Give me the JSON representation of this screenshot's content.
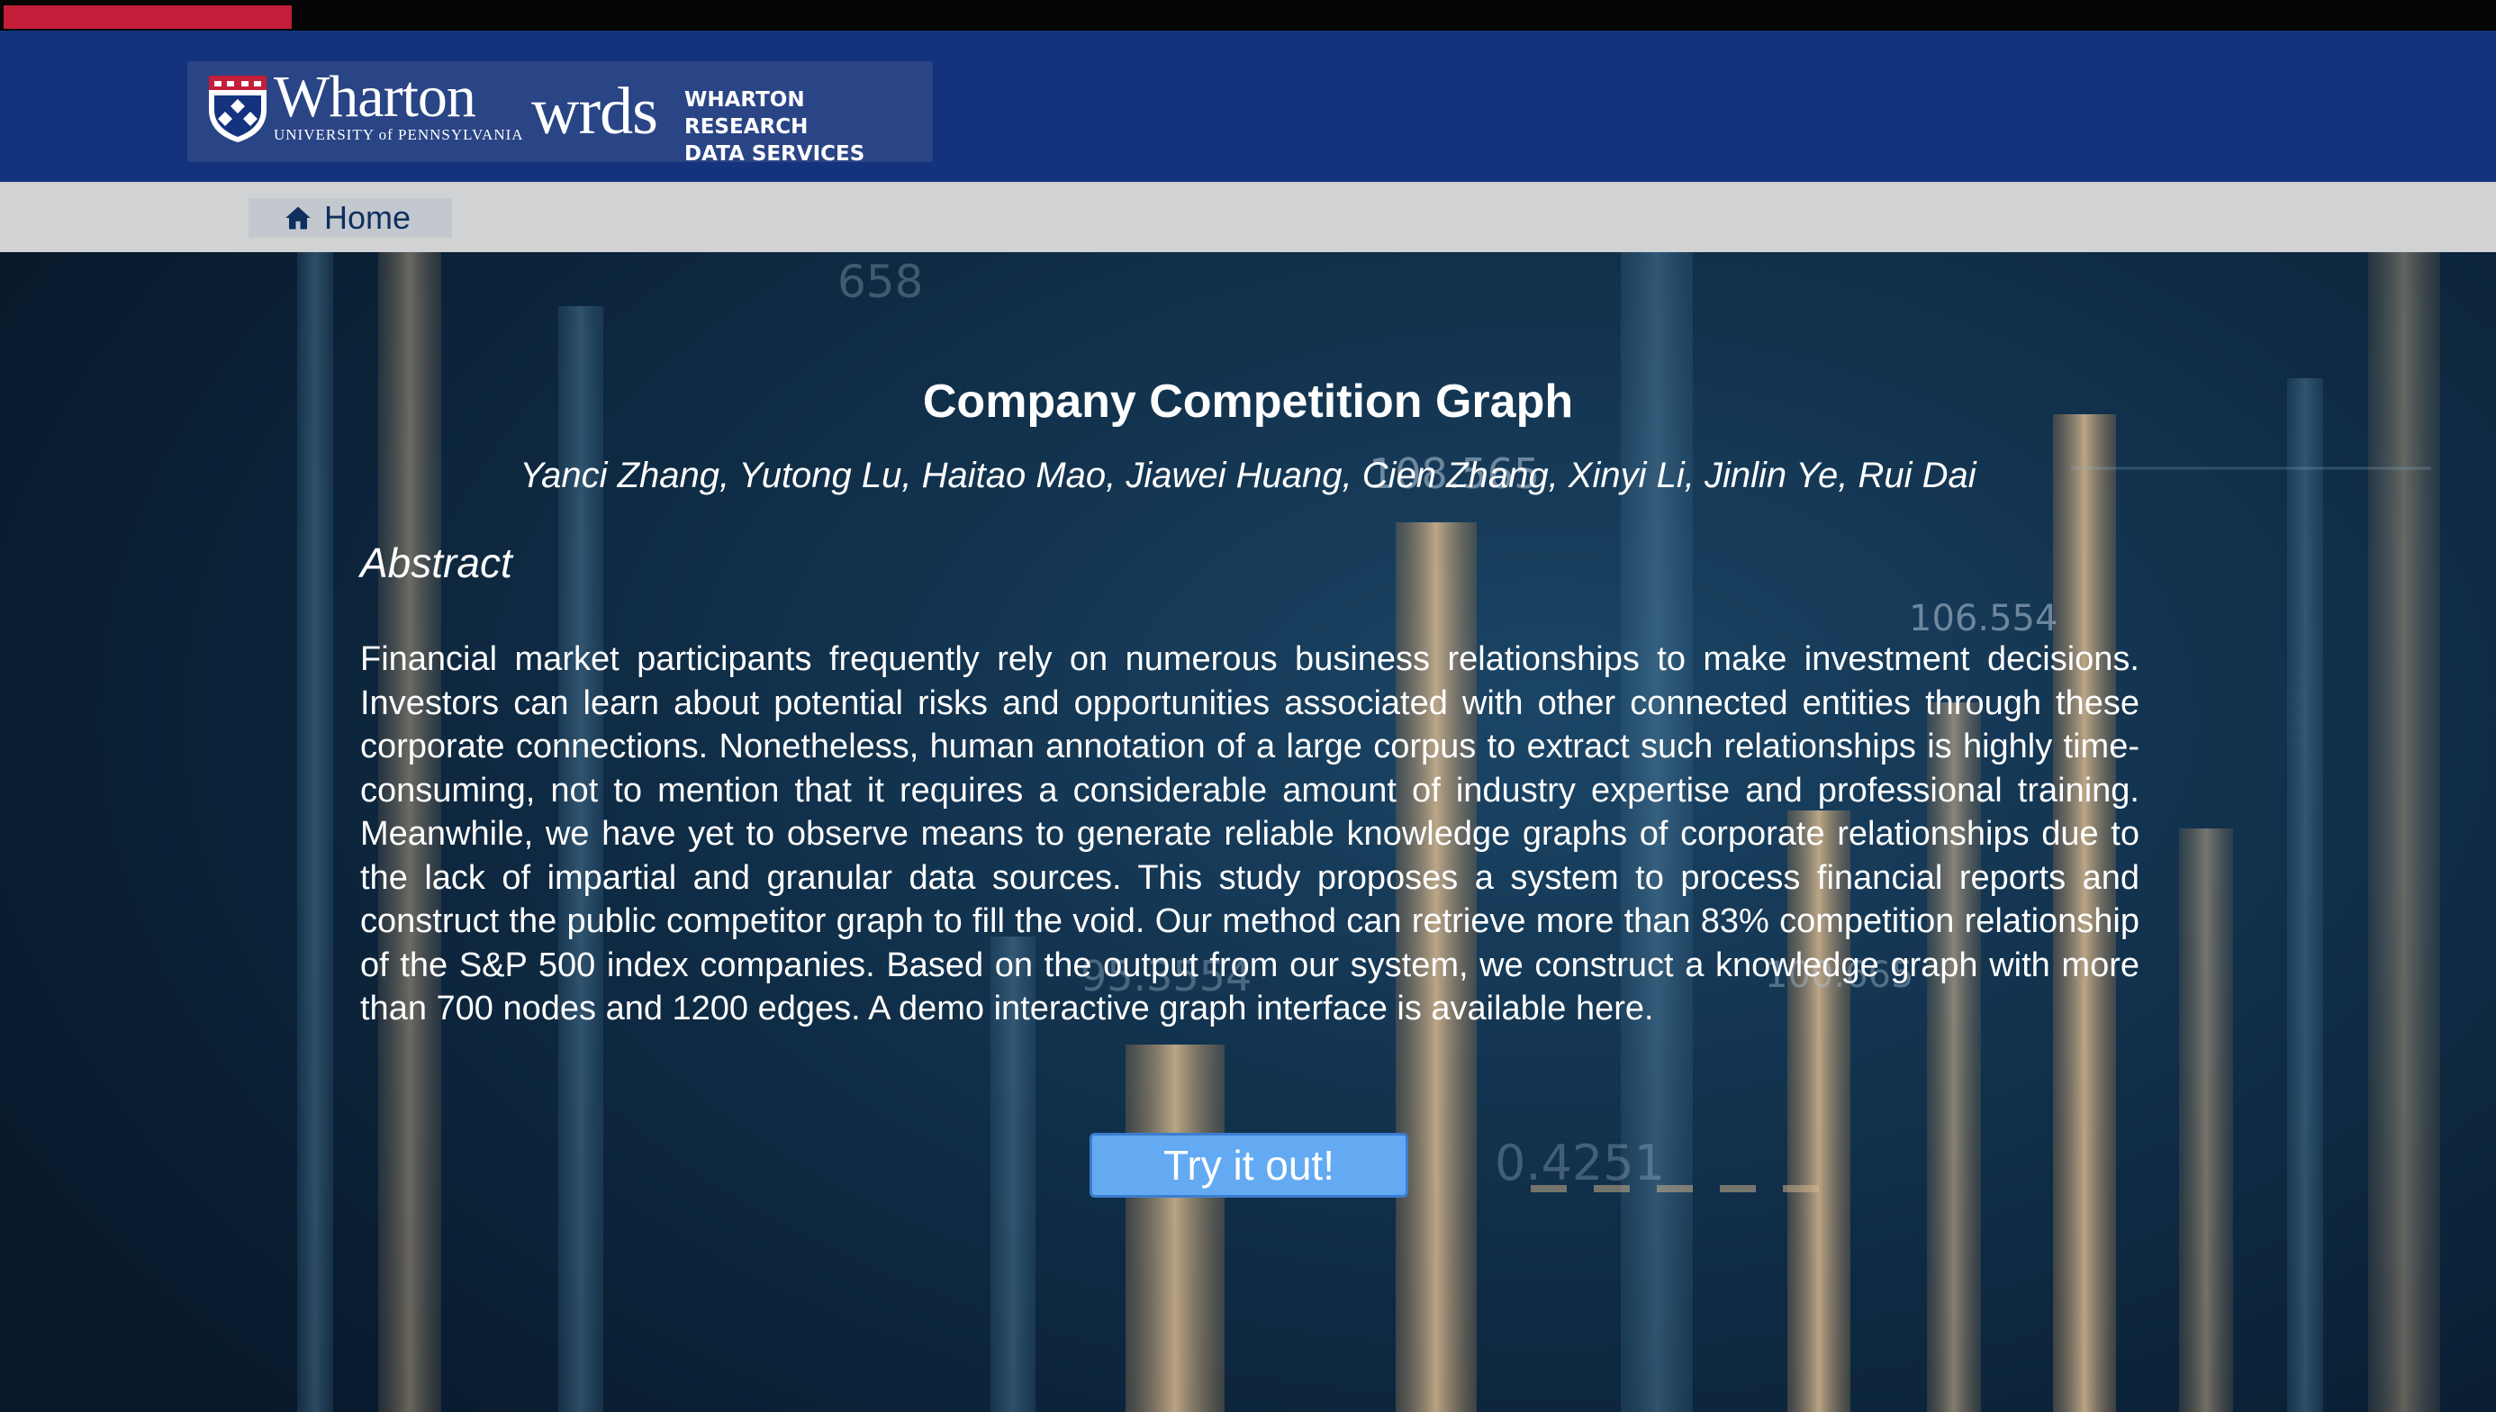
{
  "header": {
    "wharton_logo": "Wharton",
    "university": "UNIVERSITY of PENNSYLVANIA",
    "wrds_logo": "wrds",
    "wrds_tagline_line1": "WHARTON RESEARCH",
    "wrds_tagline_line2": "DATA SERVICES",
    "accent_color": "#c41e3a",
    "header_color": "#13337f"
  },
  "nav": {
    "home_label": "Home",
    "home_icon": "home-icon"
  },
  "main": {
    "title": "Company Competition Graph",
    "authors": "Yanci Zhang, Yutong Lu, Haitao Mao, Jiawei Huang, Cien Zhang, Xinyi Li, Jinlin Ye, Rui Dai",
    "abstract_heading": "Abstract",
    "abstract_text": "Financial market participants frequently rely on numerous business relationships to make investment decisions. Investors can learn about potential risks and opportunities associated with other connected entities through these corporate connections. Nonetheless, human annotation of a large corpus to extract such relationships is highly time-consuming, not to mention that it requires a considerable amount of industry expertise and professional training. Meanwhile, we have yet to observe means to generate reliable knowledge graphs of corporate relationships due to the lack of impartial and granular data sources. This study proposes a system to process financial reports and construct the public competitor graph to fill the void. Our method can retrieve more than 83% competition relationship of the S&P 500 index companies. Based on the output from our system, we construct a knowledge graph with more than 700 nodes and 1200 edges. A demo interactive graph interface is available here.",
    "button_label": "Try it out!",
    "button_color": "#63aaf3"
  },
  "background": {
    "numbers": [
      "108.565",
      "106.554",
      "100.665",
      "95.3554",
      "0.4251",
      "658"
    ]
  }
}
